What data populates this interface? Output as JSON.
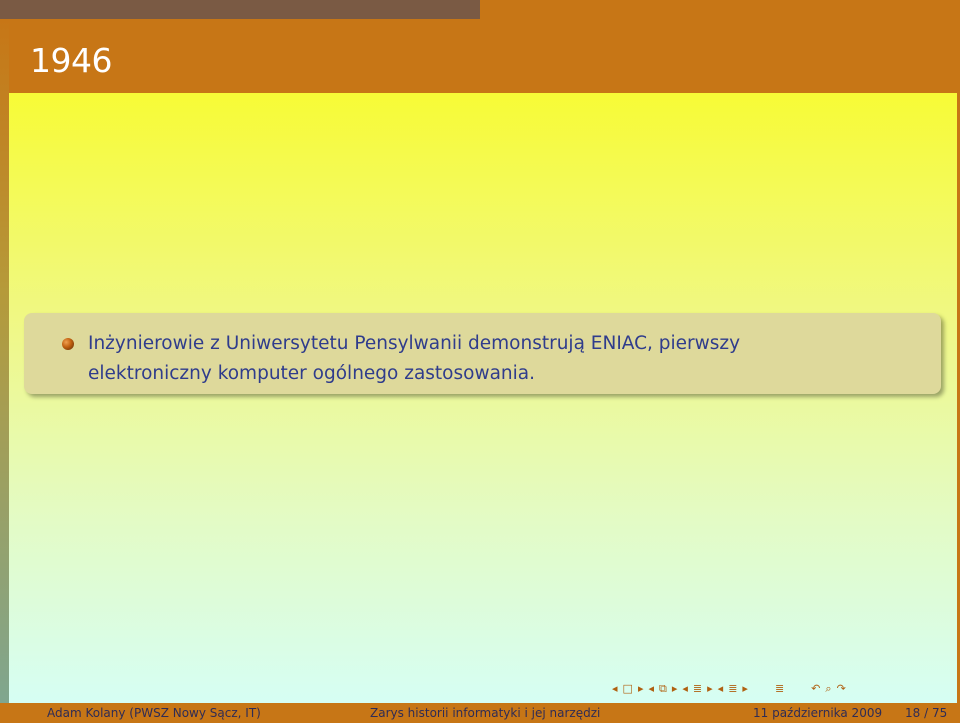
{
  "progress": {
    "fraction": 0.5
  },
  "frame": {
    "title": "1946"
  },
  "block": {
    "line1": "Inżynierowie z Uniwersytetu Pensylwanii demonstrują ENIAC, pierwszy",
    "line2": "elektroniczny komputer ogólnego zastosowania."
  },
  "navigation": {
    "icons": [
      "nav-frame-left-icon",
      "nav-frame-icon",
      "nav-frame-right-icon",
      "nav-subsection-left-icon",
      "nav-subsection-icon",
      "nav-subsection-right-icon",
      "nav-section-left-icon",
      "nav-section-icon",
      "nav-section-right-icon",
      "nav-doc-left-icon",
      "nav-doc-icon",
      "nav-doc-right-icon",
      "nav-toc-icon",
      "nav-back-icon",
      "nav-search-icon",
      "nav-forward-icon"
    ]
  },
  "footer": {
    "author": "Adam Kolany  (PWSZ Nowy Sącz, IT)",
    "title": "Zarys historii informatyki i jej narzędzi",
    "date": "11 października 2009",
    "page": "18 / 75"
  },
  "colors": {
    "accent": "#c77616",
    "text": "#2f3c8c",
    "block_bg": "#ded99b"
  }
}
